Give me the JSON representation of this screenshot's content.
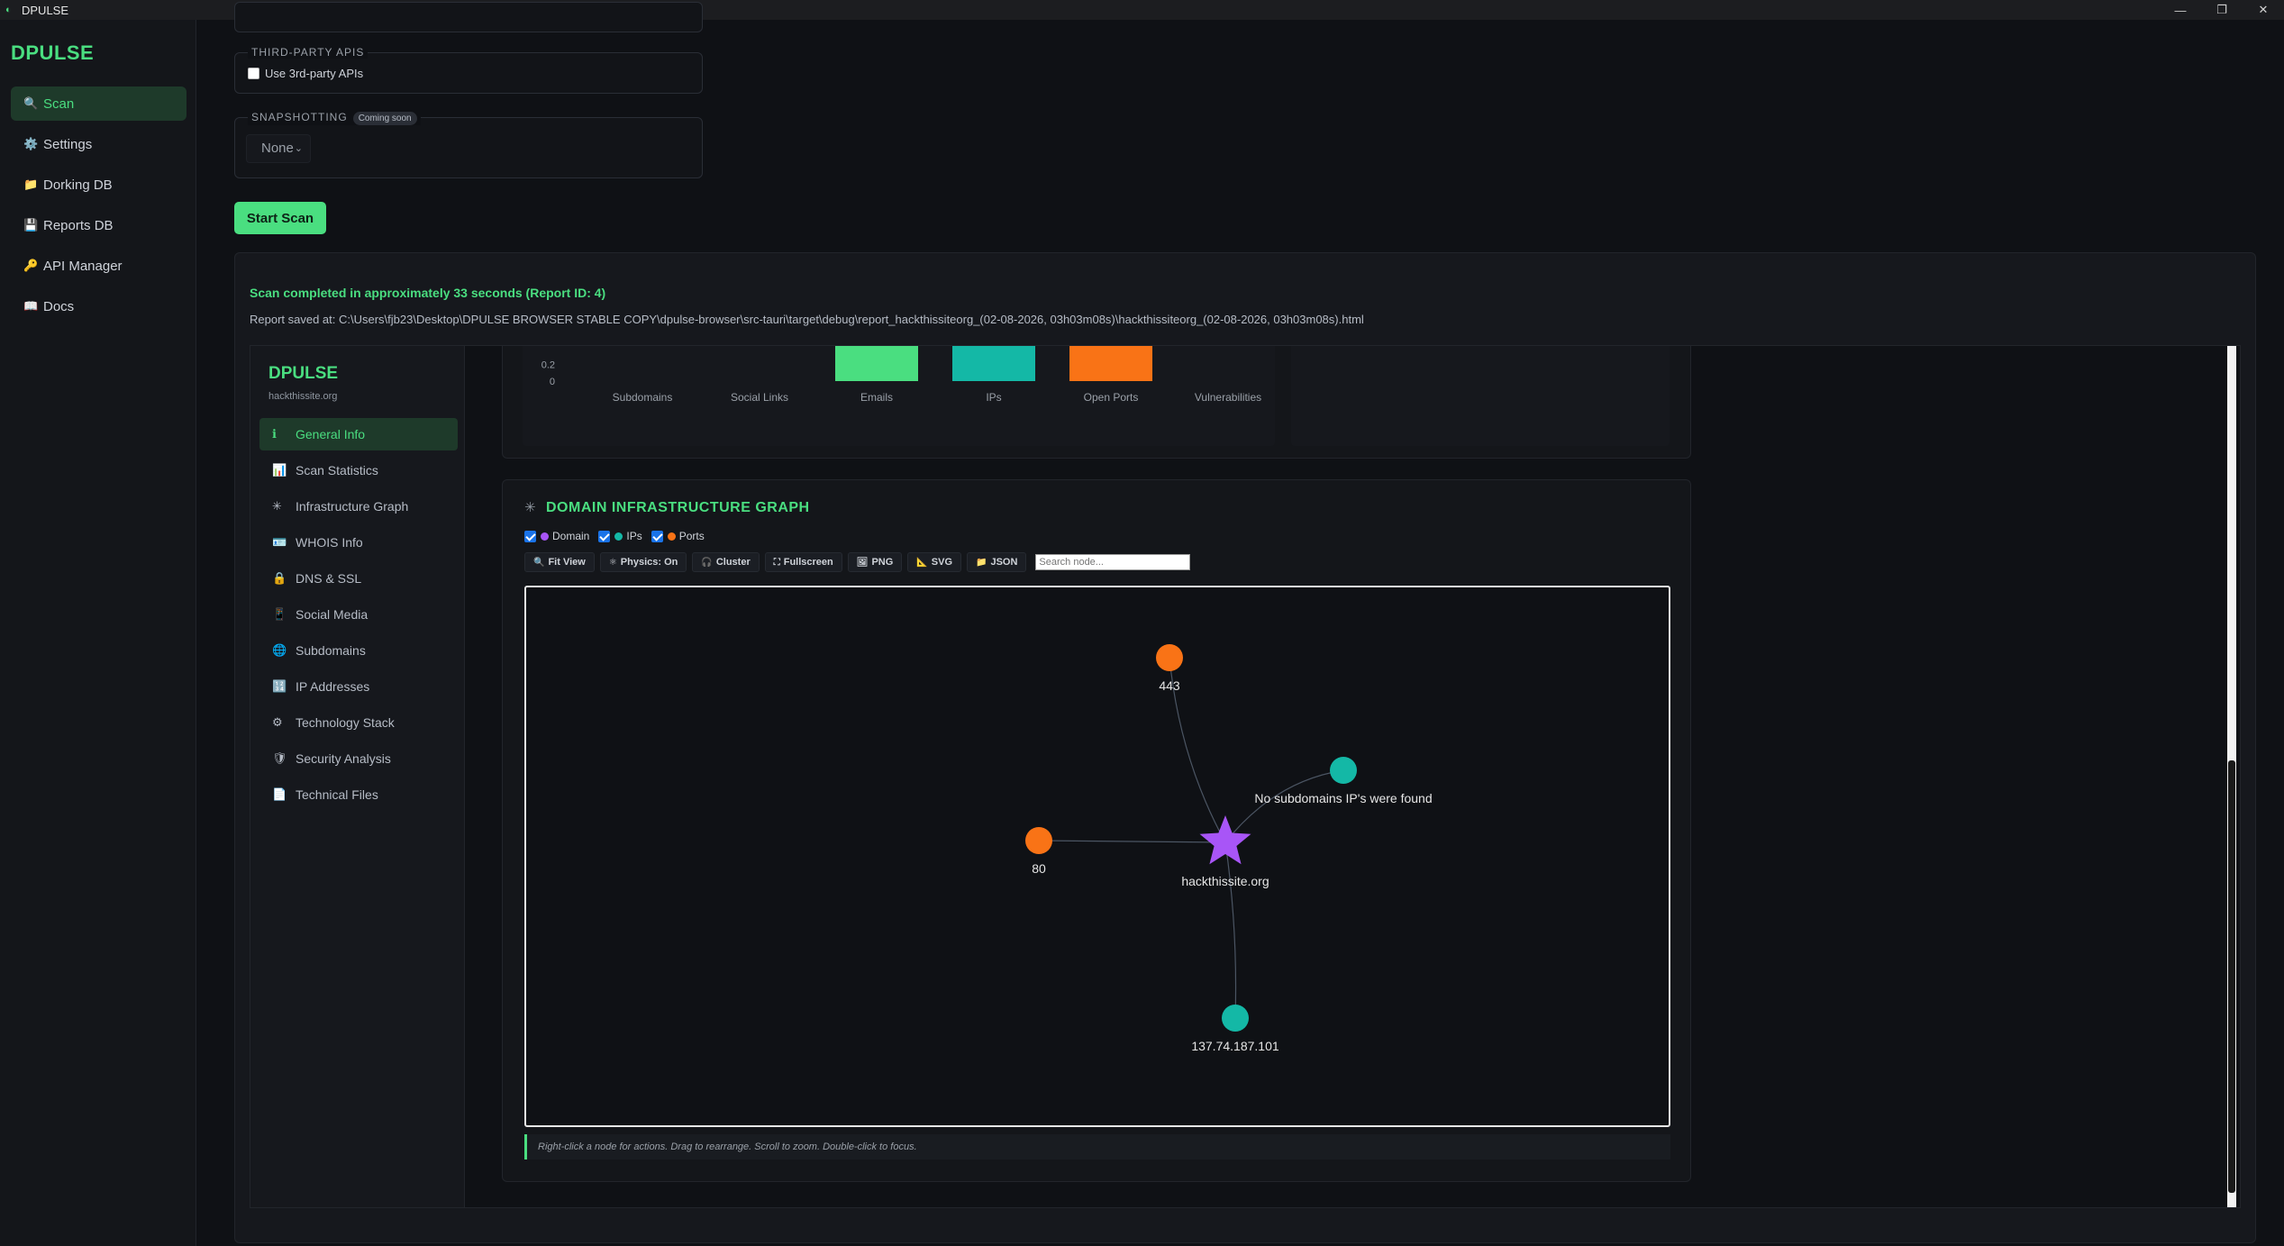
{
  "window": {
    "title": "DPULSE"
  },
  "sidebar": {
    "brand": "DPULSE",
    "items": [
      {
        "label": "Scan",
        "icon": "🔍",
        "active": true
      },
      {
        "label": "Settings",
        "icon": "⚙️",
        "active": false
      },
      {
        "label": "Dorking DB",
        "icon": "📁",
        "active": false
      },
      {
        "label": "Reports DB",
        "icon": "💾",
        "active": false
      },
      {
        "label": "API Manager",
        "icon": "🔑",
        "active": false
      },
      {
        "label": "Docs",
        "icon": "📖",
        "active": false
      }
    ]
  },
  "scan_form": {
    "third_party": {
      "legend": "THIRD-PARTY APIS",
      "checkbox_label": "Use 3rd-party APIs",
      "checked": false
    },
    "snapshotting": {
      "legend": "SNAPSHOTTING",
      "badge": "Coming soon",
      "select_value": "None"
    },
    "start_button": "Start Scan"
  },
  "results": {
    "completed": "Scan completed in approximately 33 seconds (Report ID: 4)",
    "saved_path": "Report saved at: C:\\Users\\fjb23\\Desktop\\DPULSE BROWSER STABLE COPY\\dpulse-browser\\src-tauri\\target\\debug\\report_hackthissiteorg_(02-08-2026, 03h03m08s)\\hackthissiteorg_(02-08-2026, 03h03m08s).html"
  },
  "report": {
    "brand": "DPULSE",
    "domain": "hackthissite.org",
    "nav": [
      {
        "label": "General Info",
        "icon": "ℹ",
        "active": true
      },
      {
        "label": "Scan Statistics",
        "icon": "📊",
        "active": false
      },
      {
        "label": "Infrastructure Graph",
        "icon": "✳",
        "active": false
      },
      {
        "label": "WHOIS Info",
        "icon": "🪪",
        "active": false
      },
      {
        "label": "DNS & SSL",
        "icon": "🔒",
        "active": false
      },
      {
        "label": "Social Media",
        "icon": "📱",
        "active": false
      },
      {
        "label": "Subdomains",
        "icon": "🌐",
        "active": false
      },
      {
        "label": "IP Addresses",
        "icon": "🔢",
        "active": false
      },
      {
        "label": "Technology Stack",
        "icon": "⚙",
        "active": false
      },
      {
        "label": "Security Analysis",
        "icon": "🛡",
        "active": false
      },
      {
        "label": "Technical Files",
        "icon": "📄",
        "active": false
      }
    ],
    "graph": {
      "title": "DOMAIN INFRASTRUCTURE GRAPH",
      "legend": [
        {
          "label": "Domain",
          "color": "#a855f7",
          "checked": true
        },
        {
          "label": "IPs",
          "color": "#14b8a6",
          "checked": true
        },
        {
          "label": "Ports",
          "color": "#f97316",
          "checked": true
        }
      ],
      "toolbar": [
        {
          "label": "Fit View",
          "icon": "🔍"
        },
        {
          "label": "Physics: On",
          "icon": "⚛"
        },
        {
          "label": "Cluster",
          "icon": "🎧"
        },
        {
          "label": "Fullscreen",
          "icon": "⛶"
        },
        {
          "label": "PNG",
          "icon": "🖼"
        },
        {
          "label": "SVG",
          "icon": "📐"
        },
        {
          "label": "JSON",
          "icon": "📁"
        }
      ],
      "search_placeholder": "Search node...",
      "nodes": [
        {
          "label": "hackthissite.org",
          "type": "domain"
        },
        {
          "label": "443",
          "type": "port"
        },
        {
          "label": "80",
          "type": "port"
        },
        {
          "label": "No subdomains IP's were found",
          "type": "ip"
        },
        {
          "label": "137.74.187.101",
          "type": "ip"
        }
      ],
      "hint": "Right-click a node for actions. Drag to rearrange. Scroll to zoom. Double-click to focus."
    }
  },
  "chart_data": {
    "type": "bar",
    "categories": [
      "Subdomains",
      "Social Links",
      "Emails",
      "IPs",
      "Open Ports",
      "Vulnerabilities"
    ],
    "values": [
      0,
      0,
      1,
      1,
      1,
      0
    ],
    "colors": [
      "#4ade80",
      "#4ade80",
      "#4ade80",
      "#14b8a6",
      "#f97316",
      "#4ade80"
    ],
    "y_ticks": [
      "0.2",
      "0"
    ],
    "ylim": [
      0,
      1
    ]
  }
}
